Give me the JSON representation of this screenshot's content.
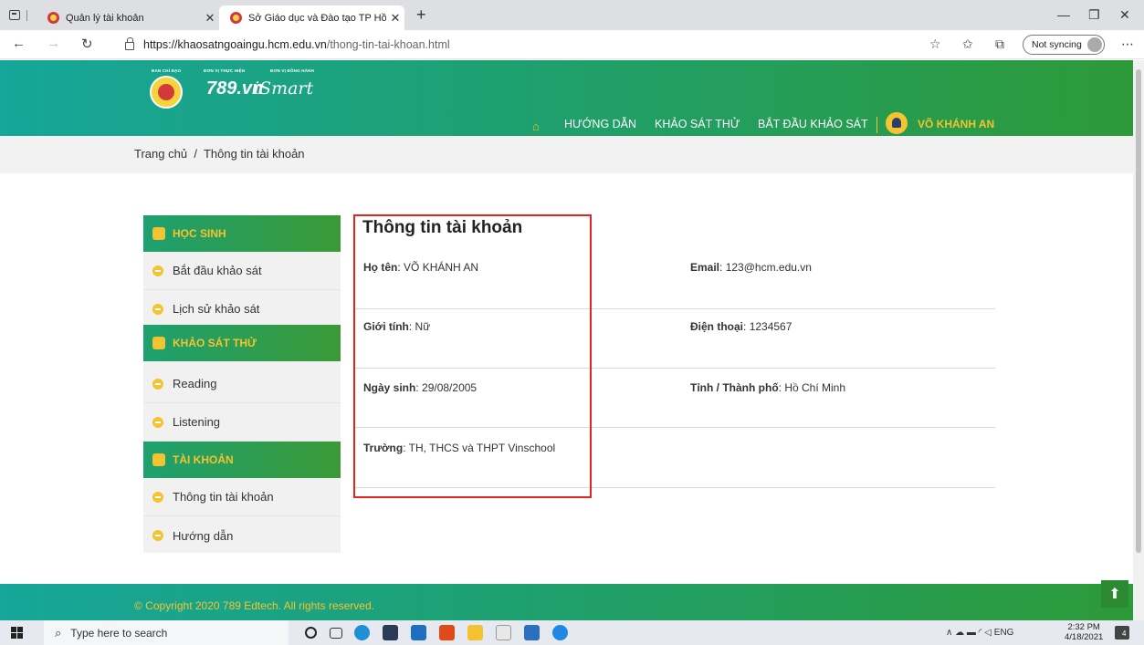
{
  "browser": {
    "tabs": [
      {
        "title": "Quản lý tài khoản",
        "active": false
      },
      {
        "title": "Sở Giáo dục và Đào tạo TP Hồ Chí Minh",
        "active": true
      }
    ],
    "url_host": "https://khaosatngoaingu.hcm.edu.vn",
    "url_path": "/thong-tin-tai-khoan.html",
    "sync_label": "Not syncing"
  },
  "header": {
    "caps": [
      "BAN CHỈ ĐẠO",
      "ĐƠN VỊ THỰC HIỆN",
      "ĐƠN VỊ ĐỒNG HÀNH"
    ],
    "logo_789": "789.vn",
    "logo_smart": "iSmart",
    "nav": [
      "HƯỚNG DẪN",
      "KHẢO SÁT THỬ",
      "BẮT ĐẦU KHẢO SÁT"
    ],
    "user_name": "VÕ KHÁNH AN"
  },
  "breadcrumb": {
    "home": "Trang chủ",
    "separator": "/",
    "current": "Thông tin tài khoản"
  },
  "sidebar": {
    "groups": [
      {
        "title": "HỌC SINH",
        "items": [
          "Bắt đầu khảo sát",
          "Lịch sử khảo sát"
        ]
      },
      {
        "title": "KHẢO SÁT THỬ",
        "items": [
          "Reading",
          "Listening"
        ]
      },
      {
        "title": "TÀI KHOẢN",
        "items": [
          "Thông tin tài khoản",
          "Hướng dẫn"
        ]
      }
    ]
  },
  "content": {
    "title": "Thông tin tài khoản",
    "fields": [
      {
        "label": "Họ tên",
        "value": "VÕ KHÁNH AN"
      },
      {
        "label": "Email",
        "value": "123@hcm.edu.vn"
      },
      {
        "label": "Giới tính",
        "value": "Nữ"
      },
      {
        "label": "Điện thoại",
        "value": "1234567"
      },
      {
        "label": "Ngày sinh",
        "value": "29/08/2005"
      },
      {
        "label": "Tỉnh / Thành phố",
        "value": "Hồ Chí Minh"
      },
      {
        "label": "Trường",
        "value": "TH, THCS và THPT Vinschool"
      }
    ]
  },
  "footer": {
    "copyright": "© Copyright 2020 789 Edtech. All rights reserved."
  },
  "taskbar": {
    "search_placeholder": "Type here to search",
    "lang": "ENG",
    "time": "2:32 PM",
    "date": "4/18/2021",
    "notifications": "4"
  },
  "colors": {
    "brand_green": "#1ea070",
    "accent_yellow": "#f4c430",
    "highlight_red": "#e5251f"
  }
}
